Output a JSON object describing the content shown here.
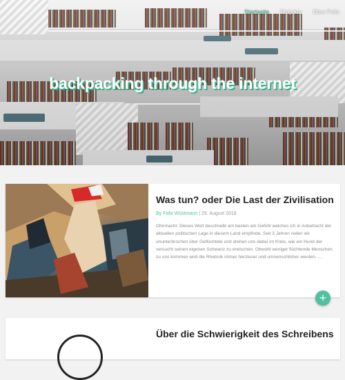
{
  "nav": {
    "items": [
      {
        "label": "Startseite",
        "active": true
      },
      {
        "label": "Projekte",
        "active": false
      },
      {
        "label": "Über Felix",
        "active": false
      }
    ]
  },
  "hero": {
    "title": "backpacking through the internet"
  },
  "posts": [
    {
      "title": "Was tun? oder Die Last der Zivilisation",
      "author": "By Felix Wüstmann",
      "date": "29. August 2018",
      "excerpt": "Ohnmacht. Dieses Wort beschreibt am besten ein Gefühl welches ich in Anbetracht der aktuellen politischen Lage in diesem Land empfinde. Seit 3 Jahren reden wir ununterbrochen über Geflüchtete und drehen uns dabei im Kreis, wie ein Hund der versucht seinen eigenen Schwanz zu erwischen. Obwohl weniger flüchtende Menschen zu uns kommen wird die Rhetorik immer herzloser und unmenschlicher werden. …"
    },
    {
      "title": "Über die Schwierigkeit des Schreibens"
    }
  ],
  "fab": {
    "label": "+"
  },
  "colors": {
    "accent": "#4fc1a0",
    "background": "#f2f2f2"
  }
}
